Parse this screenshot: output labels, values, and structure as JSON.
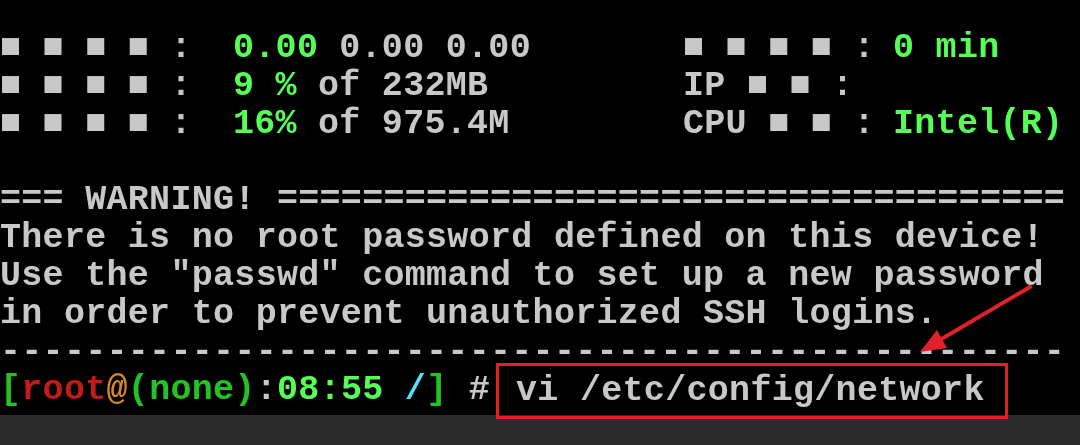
{
  "stats_left": [
    {
      "label": "■ ■ ■ ■ :",
      "value": "0.00",
      "rest": "0.00 0.00"
    },
    {
      "label": "■ ■ ■ ■ :",
      "value": "9 %",
      "rest": "of 232MB"
    },
    {
      "label": "■ ■ ■ ■ :",
      "value": "16%",
      "rest": "of 975.4M"
    }
  ],
  "stats_right": [
    {
      "label": "■ ■ ■ ■ :",
      "value": "0 min"
    },
    {
      "label": "IP ■ ■ :"
    },
    {
      "label": "CPU ■ ■ :",
      "value": "Intel(R)"
    }
  ],
  "warning_rule": "=== WARNING! =====================================",
  "warning_lines": [
    "There is no root password defined on this device!",
    "Use the \"passwd\" command to set up a new password",
    "in order to prevent unauthorized SSH logins."
  ],
  "dash_rule": "--------------------------------------------------",
  "prompt": [
    {
      "text": "[",
      "color": "#22c322"
    },
    {
      "text": "root",
      "color": "#c41a1a"
    },
    {
      "text": "@",
      "color": "#d88a20"
    },
    {
      "text": "(none)",
      "color": "#22c322"
    },
    {
      "text": ":",
      "color": "#c8c8c8"
    },
    {
      "text": "08:55",
      "color": "#55ff55"
    },
    {
      "text": " /",
      "color": "#55e0ff"
    },
    {
      "text": "]",
      "color": "#22c322"
    },
    {
      "text": " #",
      "color": "#c8c8c8"
    }
  ],
  "command": "vi /etc/config/network"
}
